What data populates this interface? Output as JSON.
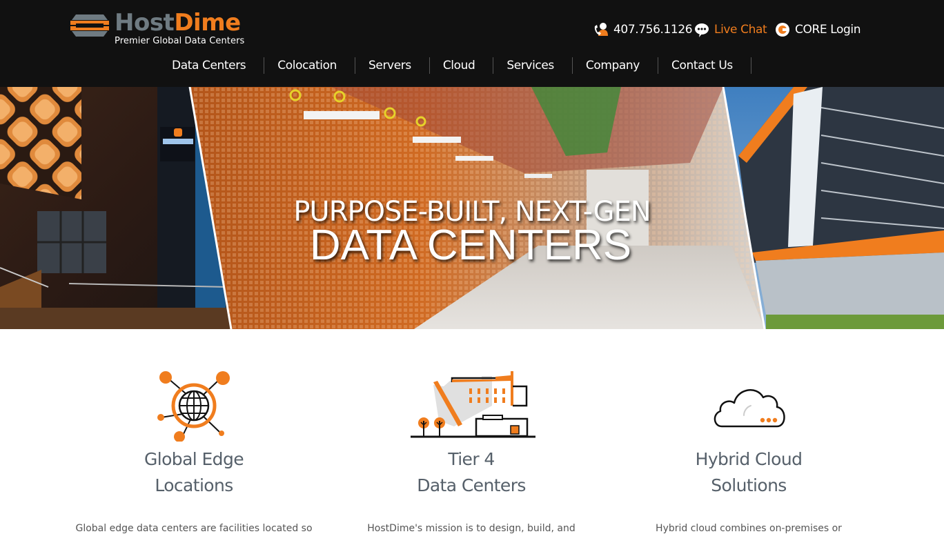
{
  "brand": {
    "name_part1": "Host",
    "name_part2": "Dime",
    "tagline": "Premier Global Data Centers",
    "colors": {
      "accent": "#f07d1e",
      "gray": "#6f7b82",
      "header_bg": "#111111"
    }
  },
  "utility": {
    "phone": {
      "icon": "phone-user-icon",
      "label": "407.756.1126"
    },
    "chat": {
      "icon": "chat-bubble-icon",
      "label": "Live Chat"
    },
    "login": {
      "icon": "core-logo-icon",
      "label": "CORE Login"
    }
  },
  "nav": {
    "items": [
      {
        "label": "Data Centers"
      },
      {
        "label": "Colocation"
      },
      {
        "label": "Servers"
      },
      {
        "label": "Cloud"
      },
      {
        "label": "Services"
      },
      {
        "label": "Company"
      },
      {
        "label": "Contact Us"
      }
    ]
  },
  "hero": {
    "line1": "PURPOSE-BUILT, NEXT-GEN",
    "line2": "DATA CENTERS",
    "panels": [
      "night-building-photo",
      "server-cage-aisle-photo",
      "modern-building-photo"
    ]
  },
  "features": [
    {
      "icon": "globe-network-icon",
      "title_line1": "Global Edge",
      "title_line2": "Locations",
      "desc": "Global edge data centers are facilities located so"
    },
    {
      "icon": "data-center-building-icon",
      "title_line1": "Tier 4",
      "title_line2": "Data Centers",
      "desc": "HostDime's mission is to design, build, and"
    },
    {
      "icon": "cloud-icon",
      "title_line1": "Hybrid Cloud",
      "title_line2": "Solutions",
      "desc": "Hybrid cloud combines on-premises or"
    }
  ]
}
